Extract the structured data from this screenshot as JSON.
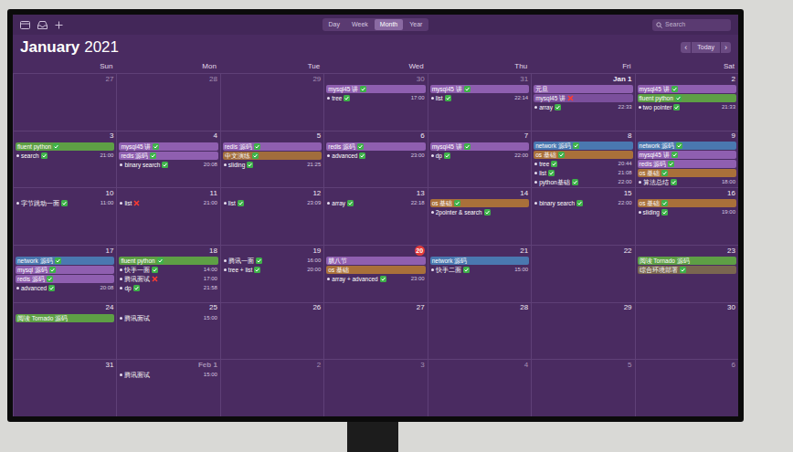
{
  "title": {
    "month": "January",
    "year": "2021"
  },
  "toolbar": {
    "views": [
      {
        "label": "Day",
        "selected": false
      },
      {
        "label": "Week",
        "selected": false
      },
      {
        "label": "Month",
        "selected": true
      },
      {
        "label": "Year",
        "selected": false
      }
    ],
    "search": {
      "placeholder": "Search"
    },
    "prev": "‹",
    "today": "Today",
    "next": "›"
  },
  "weekdays": [
    "Sun",
    "Mon",
    "Tue",
    "Wed",
    "Thu",
    "Fri",
    "Sat"
  ],
  "weeks": [
    {
      "days": [
        {
          "date": "27",
          "in_month": false,
          "today": false,
          "events": []
        },
        {
          "date": "28",
          "in_month": false,
          "today": false,
          "events": []
        },
        {
          "date": "29",
          "in_month": false,
          "today": false,
          "events": []
        },
        {
          "date": "30",
          "in_month": false,
          "today": false,
          "events": [
            {
              "kind": "bar",
              "title": "mysql45 讲",
              "color": "#8f5fb0",
              "mark": "done"
            },
            {
              "kind": "timed",
              "title": "tree",
              "time": "17:00",
              "mark": "done"
            }
          ]
        },
        {
          "date": "31",
          "in_month": false,
          "today": false,
          "events": [
            {
              "kind": "bar",
              "title": "mysql45 讲",
              "color": "#8f5fb0",
              "mark": "done"
            },
            {
              "kind": "timed",
              "title": "list",
              "time": "22:14",
              "mark": "done"
            }
          ]
        },
        {
          "date": "Jan 1",
          "in_month": true,
          "today": false,
          "events": [
            {
              "kind": "bar",
              "title": "元旦",
              "color": "#8f5fb0",
              "mark": "none"
            },
            {
              "kind": "bar",
              "title": "mysql45 讲",
              "color": "#7b4f9c",
              "mark": "failed"
            },
            {
              "kind": "timed",
              "title": "array",
              "time": "22:33",
              "mark": "done"
            }
          ]
        },
        {
          "date": "2",
          "in_month": true,
          "today": false,
          "events": [
            {
              "kind": "bar",
              "title": "mysql45 讲",
              "color": "#8f5fb0",
              "mark": "done"
            },
            {
              "kind": "bar",
              "title": "fluent python",
              "color": "#5e9f45",
              "mark": "done"
            },
            {
              "kind": "timed",
              "title": "two pointer",
              "time": "21:33",
              "mark": "done"
            }
          ]
        }
      ]
    },
    {
      "days": [
        {
          "date": "3",
          "in_month": true,
          "today": false,
          "events": [
            {
              "kind": "bar",
              "title": "fluent python",
              "color": "#5e9f45",
              "mark": "done"
            },
            {
              "kind": "timed",
              "title": "search",
              "time": "21:00",
              "mark": "done"
            }
          ]
        },
        {
          "date": "4",
          "in_month": true,
          "today": false,
          "events": [
            {
              "kind": "bar",
              "title": "mysql45 讲",
              "color": "#8f5fb0",
              "mark": "done"
            },
            {
              "kind": "bar",
              "title": "redis 源码",
              "color": "#8f5fb0",
              "mark": "done"
            },
            {
              "kind": "timed",
              "title": "binary search",
              "time": "20:08",
              "mark": "done"
            }
          ]
        },
        {
          "date": "5",
          "in_month": true,
          "today": false,
          "events": [
            {
              "kind": "bar",
              "title": "redis 源码",
              "color": "#8f5fb0",
              "mark": "done"
            },
            {
              "kind": "bar",
              "title": "中文演练",
              "color": "#a16d3c",
              "mark": "done"
            },
            {
              "kind": "timed",
              "title": "sliding",
              "time": "21:25",
              "mark": "done"
            }
          ]
        },
        {
          "date": "6",
          "in_month": true,
          "today": false,
          "events": [
            {
              "kind": "bar",
              "title": "redis 源码",
              "color": "#8f5fb0",
              "mark": "done"
            },
            {
              "kind": "timed",
              "title": "advanced",
              "time": "23:00",
              "mark": "done"
            }
          ]
        },
        {
          "date": "7",
          "in_month": true,
          "today": false,
          "events": [
            {
              "kind": "bar",
              "title": "mysql45 讲",
              "color": "#8f5fb0",
              "mark": "done"
            },
            {
              "kind": "timed",
              "title": "dp",
              "time": "22:00",
              "mark": "done"
            }
          ]
        },
        {
          "date": "8",
          "in_month": true,
          "today": false,
          "events": [
            {
              "kind": "bar",
              "title": "network 源码",
              "color": "#4a78b0",
              "mark": "done"
            },
            {
              "kind": "bar",
              "title": "os 基础",
              "color": "#a9703a",
              "mark": "done"
            },
            {
              "kind": "timed",
              "title": "tree",
              "time": "20:44",
              "mark": "done"
            },
            {
              "kind": "timed",
              "title": "list",
              "time": "21:08",
              "mark": "done"
            },
            {
              "kind": "timed",
              "title": "python基础",
              "time": "22:00",
              "mark": "done"
            }
          ]
        },
        {
          "date": "9",
          "in_month": true,
          "today": false,
          "events": [
            {
              "kind": "bar",
              "title": "network 源码",
              "color": "#4a78b0",
              "mark": "done"
            },
            {
              "kind": "bar",
              "title": "mysql45 讲",
              "color": "#8f5fb0",
              "mark": "done"
            },
            {
              "kind": "bar",
              "title": "redis 源码",
              "color": "#8f5fb0",
              "mark": "done"
            },
            {
              "kind": "bar",
              "title": "os 基础",
              "color": "#a9703a",
              "mark": "done"
            },
            {
              "kind": "timed",
              "title": "算法总结",
              "time": "18:00",
              "mark": "done"
            }
          ]
        }
      ]
    },
    {
      "days": [
        {
          "date": "10",
          "in_month": true,
          "today": false,
          "events": [
            {
              "kind": "timed",
              "title": "字节跳动一面",
              "time": "11:00",
              "mark": "done"
            }
          ]
        },
        {
          "date": "11",
          "in_month": true,
          "today": false,
          "events": [
            {
              "kind": "timed",
              "title": "list",
              "time": "21:00",
              "mark": "failed"
            }
          ]
        },
        {
          "date": "12",
          "in_month": true,
          "today": false,
          "events": [
            {
              "kind": "timed",
              "title": "list",
              "time": "23:09",
              "mark": "done"
            }
          ]
        },
        {
          "date": "13",
          "in_month": true,
          "today": false,
          "events": [
            {
              "kind": "timed",
              "title": "array",
              "time": "22:18",
              "mark": "done"
            }
          ]
        },
        {
          "date": "14",
          "in_month": true,
          "today": false,
          "events": [
            {
              "kind": "bar",
              "title": "os 基础",
              "color": "#a9703a",
              "mark": "done"
            },
            {
              "kind": "timed",
              "title": "2pointer & search",
              "time": "",
              "mark": "done"
            }
          ]
        },
        {
          "date": "15",
          "in_month": true,
          "today": false,
          "events": [
            {
              "kind": "timed",
              "title": "binary search",
              "time": "22:00",
              "mark": "done"
            }
          ]
        },
        {
          "date": "16",
          "in_month": true,
          "today": false,
          "events": [
            {
              "kind": "bar",
              "title": "os 基础",
              "color": "#a9703a",
              "mark": "done"
            },
            {
              "kind": "timed",
              "title": "sliding",
              "time": "19:00",
              "mark": "done"
            }
          ]
        }
      ]
    },
    {
      "days": [
        {
          "date": "17",
          "in_month": true,
          "today": false,
          "events": [
            {
              "kind": "bar",
              "title": "network 源码",
              "color": "#4a78b0",
              "mark": "done"
            },
            {
              "kind": "bar",
              "title": "mysql 源码",
              "color": "#8f5fb0",
              "mark": "done"
            },
            {
              "kind": "bar",
              "title": "redis 源码",
              "color": "#8f5fb0",
              "mark": "done"
            },
            {
              "kind": "timed",
              "title": "advanced",
              "time": "20:08",
              "mark": "done"
            }
          ]
        },
        {
          "date": "18",
          "in_month": true,
          "today": false,
          "events": [
            {
              "kind": "bar",
              "title": "fluent python",
              "color": "#5e9f45",
              "mark": "done"
            },
            {
              "kind": "timed",
              "title": "快手一面",
              "time": "14:00",
              "mark": "done"
            },
            {
              "kind": "timed",
              "title": "腾讯面试",
              "time": "17:00",
              "mark": "failed"
            },
            {
              "kind": "timed",
              "title": "dp",
              "time": "21:58",
              "mark": "done"
            }
          ]
        },
        {
          "date": "19",
          "in_month": true,
          "today": false,
          "events": [
            {
              "kind": "timed",
              "title": "腾讯一面",
              "time": "16:00",
              "mark": "done"
            },
            {
              "kind": "timed",
              "title": "tree + list",
              "time": "20:00",
              "mark": "done"
            }
          ]
        },
        {
          "date": "20",
          "in_month": true,
          "today": true,
          "events": [
            {
              "kind": "bar",
              "title": "腊八节",
              "color": "#8f5fb0",
              "mark": "none"
            },
            {
              "kind": "bar",
              "title": "os 基础",
              "color": "#a9703a",
              "mark": "none"
            },
            {
              "kind": "timed",
              "title": "array + advanced",
              "time": "23:00",
              "mark": "done"
            }
          ]
        },
        {
          "date": "21",
          "in_month": true,
          "today": false,
          "events": [
            {
              "kind": "bar",
              "title": "network 源码",
              "color": "#4a78b0",
              "mark": "none"
            },
            {
              "kind": "timed",
              "title": "快手二面",
              "time": "15:00",
              "mark": "done"
            }
          ]
        },
        {
          "date": "22",
          "in_month": true,
          "today": false,
          "events": []
        },
        {
          "date": "23",
          "in_month": true,
          "today": false,
          "events": [
            {
              "kind": "bar",
              "title": "阅读 Tornado 源码",
              "color": "#5e9f45",
              "mark": "none"
            },
            {
              "kind": "bar",
              "title": "综合环境部署",
              "color": "#7a6650",
              "mark": "done"
            }
          ]
        }
      ]
    },
    {
      "days": [
        {
          "date": "24",
          "in_month": true,
          "today": false,
          "events": [
            {
              "kind": "bar",
              "title": "阅读 Tornado 源码",
              "color": "#5e9f45",
              "mark": "none"
            }
          ]
        },
        {
          "date": "25",
          "in_month": true,
          "today": false,
          "events": [
            {
              "kind": "timed",
              "title": "腾讯面试",
              "time": "15:00",
              "mark": "none"
            }
          ]
        },
        {
          "date": "26",
          "in_month": true,
          "today": false,
          "events": []
        },
        {
          "date": "27",
          "in_month": true,
          "today": false,
          "events": []
        },
        {
          "date": "28",
          "in_month": true,
          "today": false,
          "events": []
        },
        {
          "date": "29",
          "in_month": true,
          "today": false,
          "events": []
        },
        {
          "date": "30",
          "in_month": true,
          "today": false,
          "events": []
        }
      ]
    },
    {
      "days": [
        {
          "date": "31",
          "in_month": true,
          "today": false,
          "events": []
        },
        {
          "date": "Feb 1",
          "in_month": false,
          "today": false,
          "events": [
            {
              "kind": "timed",
              "title": "腾讯面试",
              "time": "15:00",
              "mark": "none"
            }
          ]
        },
        {
          "date": "2",
          "in_month": false,
          "today": false,
          "events": []
        },
        {
          "date": "3",
          "in_month": false,
          "today": false,
          "events": []
        },
        {
          "date": "4",
          "in_month": false,
          "today": false,
          "events": []
        },
        {
          "date": "5",
          "in_month": false,
          "today": false,
          "events": []
        },
        {
          "date": "6",
          "in_month": false,
          "today": false,
          "events": []
        }
      ]
    }
  ]
}
